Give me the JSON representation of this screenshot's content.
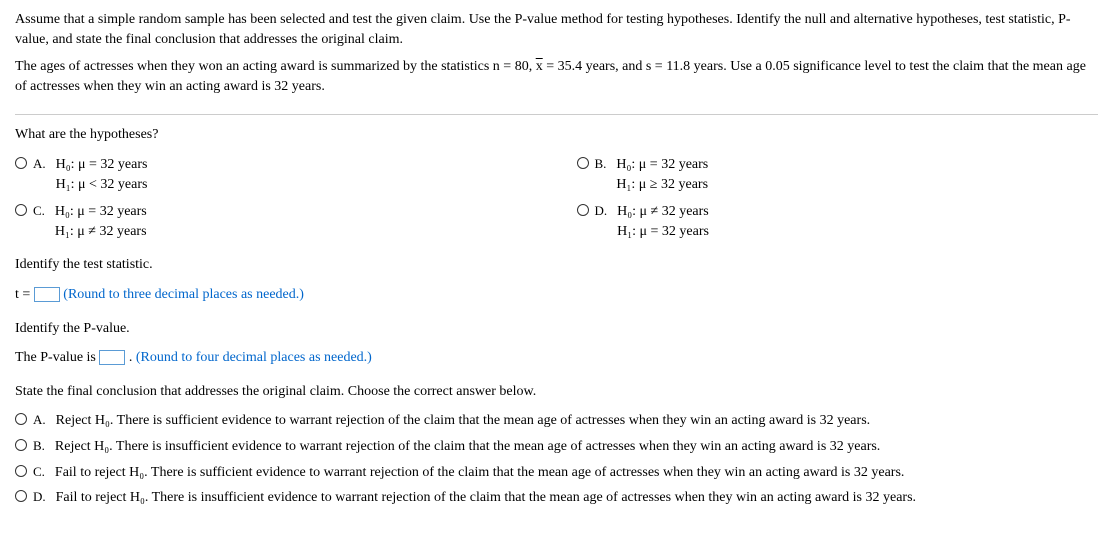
{
  "intro": "Assume that a simple random sample has been selected and test the given claim. Use the P-value method for testing hypotheses. Identify the null and alternative hypotheses, test statistic, P-value, and state the final conclusion that addresses the original claim.",
  "details_pre": "The ages of actresses when they won an acting award is summarized by the statistics n = 80, ",
  "details_xbar": "x",
  "details_post": " = 35.4 years, and s = 11.8 years. Use a 0.05 significance level to test the claim that the mean age of actresses when they win an acting award is 32 years.",
  "q1": "What are the hypotheses?",
  "labels": {
    "A": "A.",
    "B": "B.",
    "C": "C.",
    "D": "D."
  },
  "hyp": {
    "A": {
      "h0": "H₀: μ = 32 years",
      "h1": "H₁: μ < 32 years"
    },
    "B": {
      "h0": "H₀: μ = 32 years",
      "h1": "H₁: μ ≥ 32 years"
    },
    "C": {
      "h0": "H₀: μ = 32 years",
      "h1": "H₁: μ ≠ 32 years"
    },
    "D": {
      "h0": "H₀: μ ≠ 32 years",
      "h1": "H₁: μ = 32 years"
    }
  },
  "identify_t": "Identify the test statistic.",
  "t_prefix": "t = ",
  "t_instr": "(Round to three decimal places as needed.)",
  "identify_p": "Identify the P-value.",
  "p_prefix": "The P-value is ",
  "p_suffix": ". ",
  "p_instr": "(Round to four decimal places as needed.)",
  "conclusion_q": "State the final conclusion that addresses the original claim. Choose the correct answer below.",
  "conc": {
    "A": "Reject H₀. There is sufficient evidence to warrant rejection of the claim that the mean age of actresses when they win an acting award is 32 years.",
    "B": "Reject H₀. There is insufficient evidence to warrant rejection of the claim that the mean age of actresses when they win an acting award is 32 years.",
    "C": "Fail to reject H₀. There is sufficient evidence to warrant rejection of the claim that the mean age of actresses when they win an acting award is 32 years.",
    "D": "Fail to reject H₀. There is insufficient evidence to warrant rejection of the claim that the mean age of actresses when they win an acting award is 32 years."
  }
}
